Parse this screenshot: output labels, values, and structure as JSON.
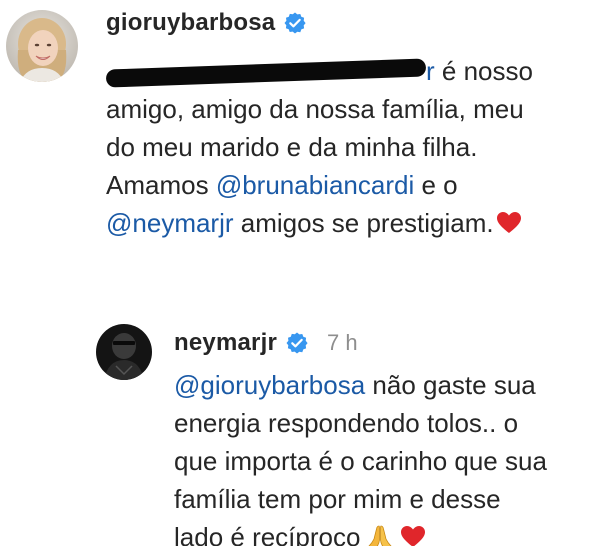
{
  "comment1": {
    "username": "gioruybarbosa",
    "verified": true,
    "line1_redacted_end": "r",
    "line1_rest": " é nosso",
    "line2": "amigo, amigo da nossa família, meu",
    "line3": "do meu marido e da minha filha.",
    "line4_pre": "Amamos ",
    "line4_mention": "@brunabiancardi",
    "line4_post": " e o",
    "line5_mention": "@neymarjr",
    "line5_post": " amigos se prestigiam.",
    "emoji_end": "heart-emoji"
  },
  "comment2": {
    "username": "neymarjr",
    "verified": true,
    "time": "7 h",
    "line1_mention": "@gioruybarbosa",
    "line1_post": " não gaste sua",
    "line2": "energia respondendo tolos.. o",
    "line3": "que importa é o carinho que sua",
    "line4": "família tem por mim e desse",
    "line5": "lado é recíproco",
    "emojis": [
      "pray-emoji",
      "heart-emoji"
    ]
  },
  "colors": {
    "mention": "#1b5aa6",
    "verified_badge": "#3897f0",
    "heart": "#e0262b",
    "text": "#262626",
    "timestamp": "#8e8e8e"
  }
}
